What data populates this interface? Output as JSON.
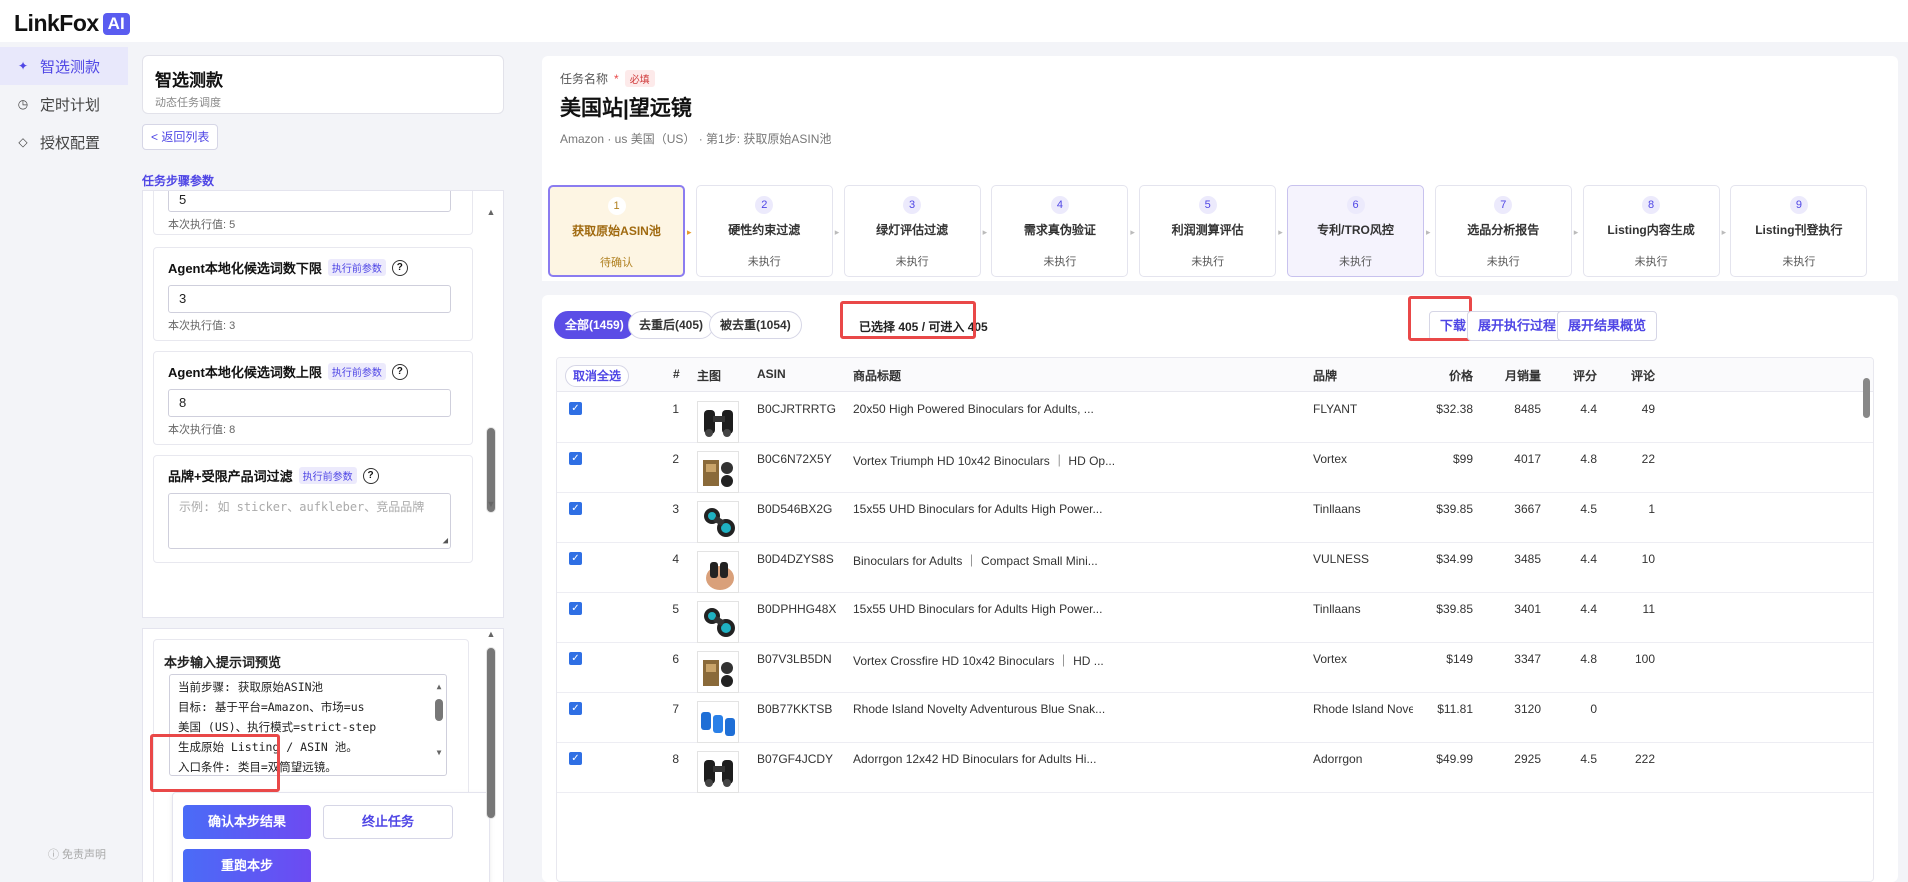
{
  "brand": {
    "name": "LinkFox",
    "badge": "AI"
  },
  "nav": {
    "items": [
      {
        "label": "智选测款",
        "icon": "sparkle-icon",
        "active": true
      },
      {
        "label": "定时计划",
        "icon": "clock-icon",
        "active": false
      },
      {
        "label": "授权配置",
        "icon": "diamond-icon",
        "active": false
      }
    ],
    "disclaimer": "ⓘ 免责声明"
  },
  "panel": {
    "title": "智选测款",
    "subtitle": "动态任务调度",
    "back_label": "< 返回列表",
    "section_label": "任务步骤参数",
    "prev_note": "本次执行值: 5",
    "prev_value": "5",
    "params": [
      {
        "title": "Agent本地化候选词数下限",
        "tag": "执行前参数",
        "value": "3",
        "note": "本次执行值: 3"
      },
      {
        "title": "Agent本地化候选词数上限",
        "tag": "执行前参数",
        "value": "8",
        "note": "本次执行值: 8"
      }
    ],
    "brand_filter": {
      "title": "品牌+受限产品词过滤",
      "tag": "执行前参数",
      "placeholder": "示例: 如 sticker、aufkleber、竞品品牌"
    },
    "help_glyph": "?",
    "prompt": {
      "title": "本步输入提示词预览",
      "lines": [
        "当前步骤: 获取原始ASIN池",
        "目标: 基于平台=Amazon、市场=us",
        "美国 (US)、执行模式=strict-step",
        "生成原始 Listing / ASIN 池。",
        "入口条件: 类目=双筒望远镜。"
      ]
    },
    "buttons": {
      "confirm": "确认本步结果",
      "terminate": "终止任务",
      "rerun": "重跑本步"
    }
  },
  "header": {
    "label": "任务名称",
    "required_star": "*",
    "required_tag": "必填",
    "title": "美国站|望远镜",
    "subtitle": "Amazon · us 美国（US） · 第1步: 获取原始ASIN池"
  },
  "steps": [
    {
      "num": "1",
      "name": "获取原始ASIN池",
      "status": "待确认",
      "state": "current"
    },
    {
      "num": "2",
      "name": "硬性约束过滤",
      "status": "未执行",
      "state": "normal"
    },
    {
      "num": "3",
      "name": "绿灯评估过滤",
      "status": "未执行",
      "state": "normal"
    },
    {
      "num": "4",
      "name": "需求真伪验证",
      "status": "未执行",
      "state": "normal"
    },
    {
      "num": "5",
      "name": "利润测算评估",
      "status": "未执行",
      "state": "normal"
    },
    {
      "num": "6",
      "name": "专利/TRO风控",
      "status": "未执行",
      "state": "highlight"
    },
    {
      "num": "7",
      "name": "选品分析报告",
      "status": "未执行",
      "state": "normal"
    },
    {
      "num": "8",
      "name": "Listing内容生成",
      "status": "未执行",
      "state": "normal"
    },
    {
      "num": "9",
      "name": "Listing刊登执行",
      "status": "未执行",
      "state": "normal"
    }
  ],
  "filters": [
    {
      "label": "全部(1459)",
      "active": true
    },
    {
      "label": "去重后(405)",
      "active": false
    },
    {
      "label": "被去重(1054)",
      "active": false
    }
  ],
  "selected_text": "已选择 405 / 可进入 405",
  "actions": {
    "download": "下载",
    "expand_process": "展开执行过程",
    "expand_overview": "展开结果概览"
  },
  "table": {
    "deselect_all": "取消全选",
    "columns": [
      "#",
      "主图",
      "ASIN",
      "商品标题",
      "品牌",
      "价格",
      "月销量",
      "评分",
      "评论"
    ],
    "rows": [
      {
        "n": "1",
        "asin": "B0CJRTRRTG",
        "title": "20x50 High Powered Binoculars for Adults, ...",
        "brand": "FLYANT",
        "price": "$32.38",
        "sales": "8485",
        "rating": "4.4",
        "reviews": "49",
        "img": "black"
      },
      {
        "n": "2",
        "asin": "B0C6N72X5Y",
        "title": "Vortex Triumph HD 10x42 Binoculars ｜ HD Op...",
        "brand": "Vortex",
        "price": "$99",
        "sales": "4017",
        "rating": "4.8",
        "reviews": "22",
        "img": "box"
      },
      {
        "n": "3",
        "asin": "B0D546BX2G",
        "title": "15x55 UHD Binoculars for Adults High Power...",
        "brand": "Tinllaans",
        "price": "$39.85",
        "sales": "3667",
        "rating": "4.5",
        "reviews": "1",
        "img": "teal"
      },
      {
        "n": "4",
        "asin": "B0D4DZYS8S",
        "title": "Binoculars for Adults ｜ Compact Small Mini...",
        "brand": "VULNESS",
        "price": "$34.99",
        "sales": "3485",
        "rating": "4.4",
        "reviews": "10",
        "img": "hand"
      },
      {
        "n": "5",
        "asin": "B0DPHHG48X",
        "title": "15x55 UHD Binoculars for Adults High Power...",
        "brand": "Tinllaans",
        "price": "$39.85",
        "sales": "3401",
        "rating": "4.4",
        "reviews": "11",
        "img": "teal"
      },
      {
        "n": "6",
        "asin": "B07V3LB5DN",
        "title": "Vortex Crossfire HD 10x42 Binoculars ｜ HD ...",
        "brand": "Vortex",
        "price": "$149",
        "sales": "3347",
        "rating": "4.8",
        "reviews": "100",
        "img": "box"
      },
      {
        "n": "7",
        "asin": "B0B77KKTSB",
        "title": "Rhode Island Novelty Adventurous Blue Snak...",
        "brand": "Rhode Island Novelty",
        "price": "$11.81",
        "sales": "3120",
        "rating": "0",
        "reviews": "",
        "img": "blue"
      },
      {
        "n": "8",
        "asin": "B07GF4JCDY",
        "title": "Adorrgon 12x42 HD Binoculars for Adults Hi...",
        "brand": "Adorrgon",
        "price": "$49.99",
        "sales": "2925",
        "rating": "4.5",
        "reviews": "222",
        "img": "black"
      }
    ]
  },
  "colors": {
    "accent": "#4f46e5",
    "highlight_red": "#e94848",
    "current_step_bg": "#fdf5e3"
  }
}
